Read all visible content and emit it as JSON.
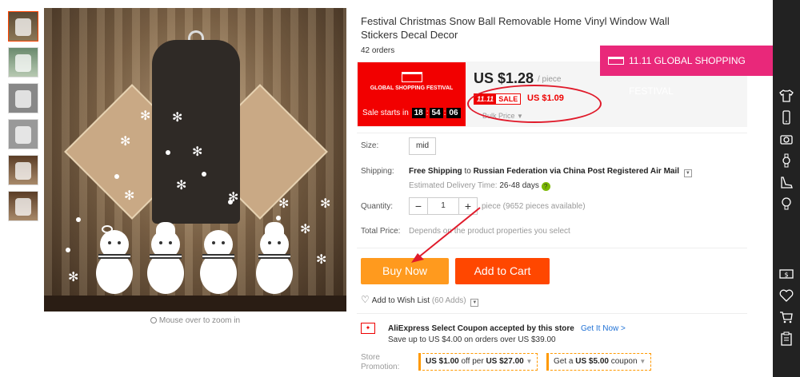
{
  "product": {
    "title": "Festival Christmas Snow Ball Removable Home Vinyl Window Wall Stickers Decal Decor",
    "orders": "42 orders",
    "zoom_hint": "Mouse over to zoom in"
  },
  "festival_card": {
    "logo_text": "GLOBAL SHOPPING FESTIVAL",
    "sale_starts_label": "Sale starts in",
    "countdown": {
      "h": "18",
      "m": "54",
      "s": "06"
    },
    "color": "#f20000"
  },
  "pricing": {
    "price": "US $1.28",
    "per": "/ piece",
    "badge_event": "11.11",
    "badge_sale": "SALE",
    "sale_price": "US $1.09",
    "bulk": "Bulk Price"
  },
  "banner": {
    "text": "11.11 GLOBAL SHOPPING FESTIVAL",
    "color": "#e9287a"
  },
  "options": {
    "size_label": "Size:",
    "size_value": "mid",
    "shipping_label": "Shipping:",
    "shipping_free": "Free Shipping",
    "shipping_to": "to",
    "shipping_dest": "Russian Federation via China Post Registered Air Mail",
    "est_label": "Estimated Delivery Time:",
    "est_value": "26-48 days",
    "quantity_label": "Quantity:",
    "quantity_minus": "−",
    "quantity_value": "1",
    "quantity_plus": "+",
    "availability": "piece (9652 pieces available)",
    "total_label": "Total Price:",
    "total_value": "Depends on the product properties you select"
  },
  "actions": {
    "buy_now": "Buy Now",
    "add_to_cart": "Add to Cart",
    "wish_label": "Add to Wish List",
    "wish_count": "(60 Adds)"
  },
  "coupon": {
    "title": "AliExpress Select Coupon accepted by this store",
    "get_it": "Get It Now >",
    "sub": "Save up to US $4.00 on orders over US $39.00",
    "promo_label": "Store Promotion:",
    "promo1_amt": "US $1.00",
    "promo1_mid": "off per",
    "promo1_min": "US $27.00",
    "promo2_pre": "Get a",
    "promo2_amt": "US $5.00",
    "promo2_post": "coupon"
  },
  "sidebar_icons": [
    "tshirt-icon",
    "phone-icon",
    "camera-icon",
    "watch-icon",
    "shoe-icon",
    "bulb-icon",
    "currency-icon",
    "heart-icon",
    "cart-icon",
    "clipboard-icon"
  ],
  "colors": {
    "buy": "#ff9a1e",
    "cart": "#ff4700",
    "sale_red": "#e00",
    "link": "#2273d6"
  }
}
